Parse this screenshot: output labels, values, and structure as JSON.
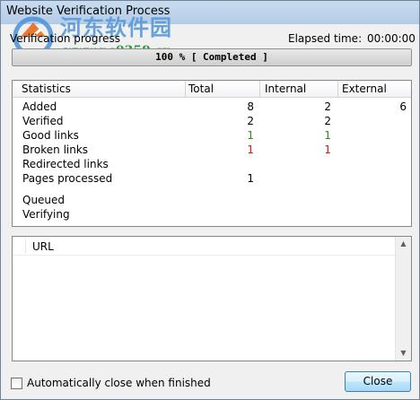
{
  "window": {
    "title": "Website Verification Process"
  },
  "watermark": {
    "cn_text": "河东软件园",
    "url_text": "www.pc0359.cn"
  },
  "progress": {
    "label": "Verification progress",
    "elapsed_label": "Elapsed time:",
    "elapsed_value": "00:00:00",
    "percent": 100,
    "bar_text": "100 %  [ Completed ]"
  },
  "stats": {
    "columns": [
      "Statistics",
      "Total",
      "Internal",
      "External"
    ],
    "rows": {
      "added": {
        "label": "Added",
        "total": "8",
        "internal": "2",
        "external": "6"
      },
      "verified": {
        "label": "Verified",
        "total": "2",
        "internal": "2",
        "external": ""
      },
      "good": {
        "label": "Good links",
        "total": "1",
        "internal": "1",
        "external": ""
      },
      "broken": {
        "label": "Broken links",
        "total": "1",
        "internal": "1",
        "external": ""
      },
      "redirected": {
        "label": "Redirected links",
        "total": "",
        "internal": "",
        "external": ""
      },
      "pages": {
        "label": "Pages processed",
        "total": "1",
        "internal": "",
        "external": ""
      },
      "queued": {
        "label": "Queued",
        "total": "",
        "internal": "",
        "external": ""
      },
      "verifying": {
        "label": "Verifying",
        "total": "",
        "internal": "",
        "external": ""
      }
    },
    "colors": {
      "good": "#2e8b1e",
      "broken": "#d11a1a"
    }
  },
  "url_list": {
    "column": "URL"
  },
  "footer": {
    "auto_close_label": "Automatically close when finished",
    "close_label": "Close"
  }
}
